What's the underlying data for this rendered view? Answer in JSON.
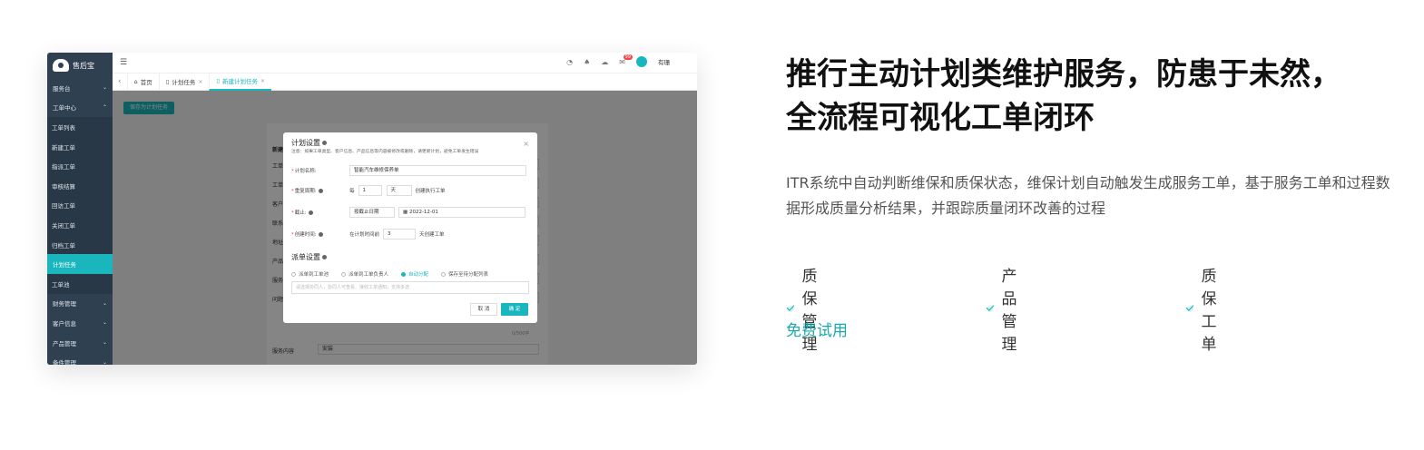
{
  "mock": {
    "logo_text": "售后宝",
    "nav": [
      {
        "label": "服务台",
        "type": "group",
        "chev": "⌄"
      },
      {
        "label": "工单中心",
        "type": "group",
        "chev": "⌃"
      },
      {
        "label": "工单列表",
        "type": "sub",
        "chev": ""
      },
      {
        "label": "新建工单",
        "type": "sub",
        "chev": ""
      },
      {
        "label": "指派工单",
        "type": "sub",
        "chev": ""
      },
      {
        "label": "审核结算",
        "type": "sub",
        "chev": ""
      },
      {
        "label": "回访工单",
        "type": "sub",
        "chev": ""
      },
      {
        "label": "关闭工单",
        "type": "sub",
        "chev": ""
      },
      {
        "label": "归档工单",
        "type": "sub",
        "chev": ""
      },
      {
        "label": "计划任务",
        "type": "active",
        "chev": ""
      },
      {
        "label": "工单池",
        "type": "sub",
        "chev": ""
      },
      {
        "label": "财务管理",
        "type": "group",
        "chev": "⌄"
      },
      {
        "label": "客户信息",
        "type": "group",
        "chev": "⌄"
      },
      {
        "label": "产品管理",
        "type": "group",
        "chev": "⌄"
      },
      {
        "label": "备件管理",
        "type": "group",
        "chev": "⌄"
      }
    ],
    "user_name": "有珊",
    "notify_count": "99",
    "tabs": {
      "home": "首页",
      "plan": "计划任务",
      "new_plan": "新建计划任务"
    },
    "save_button": "保存为计划任务",
    "form": {
      "title": "新建",
      "fields": [
        "工单",
        "工单",
        "客户",
        "联系",
        "地址",
        "产品",
        "服务",
        "问题"
      ],
      "service_label": "服务内容",
      "service_value": "安装",
      "count_hint": "0/500字"
    },
    "modal": {
      "title": "计划设置",
      "note": "注意：如果工单类型、客户信息、产品信息等内容被修改或删除，请更新计划，避免工单发生错误",
      "name_label": "计划名称:",
      "name_value": "智能汽车维修保养单",
      "cycle_label": "重复周期:",
      "cycle_prefix": "每",
      "cycle_num": "1",
      "cycle_unit": "天",
      "cycle_suffix": "创建执行工单",
      "end_label": "截止:",
      "end_type": "按截止日期",
      "end_date": "2022-12-01",
      "create_label": "创建时间:",
      "create_prefix": "在计划时间前",
      "create_num": "3",
      "create_suffix": "天创建工单",
      "dispatch_title": "派单设置",
      "dispatch_options": [
        "派单到工单池",
        "派单到工单负责人",
        "自动分配",
        "保存至待分配列表"
      ],
      "dispatch_selected": "自动分配",
      "placeholder": "请选择协同人，协同人可查看、接收工单通知，支持多选",
      "cancel": "取 消",
      "confirm": "确 定"
    }
  },
  "headline": "推行主动计划类维护服务，防患于未然，全流程可视化工单闭环",
  "description": "ITR系统中自动判断维保和质保状态，维保计划自动触发生成服务工单，基于服务工单和过程数据形成质量分析结果，并跟踪质量闭环改善的过程",
  "features": [
    "质保管理",
    "产品管理",
    "质保工单"
  ],
  "cta": "免费试用",
  "colors": {
    "accent": "#19b6bd",
    "sidebar": "#2f4050",
    "cta": "#19a8ae"
  }
}
